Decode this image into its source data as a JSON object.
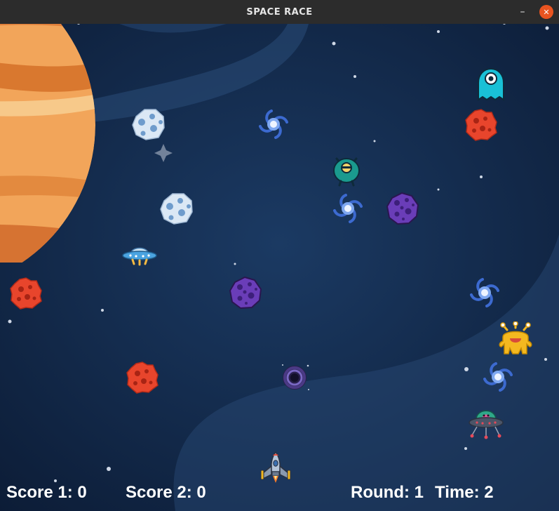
{
  "window": {
    "title": "SPACE RACE",
    "minimize_glyph": "–",
    "close_glyph": "✕"
  },
  "hud": {
    "score1_label": "Score 1:",
    "score1_value": "0",
    "score2_label": "Score 2:",
    "score2_value": "0",
    "round_label": "Round:",
    "round_value": "1",
    "time_label": "Time:",
    "time_value": "2"
  },
  "colors": {
    "space_bg": "#0d1f3c",
    "titlebar": "#2c2c2c",
    "close_button": "#e95420",
    "planet_orange": "#f0a050",
    "meteor_red": "#e8452c",
    "asteroid_purple": "#6a3db8",
    "asteroid_ice": "#dbe8f5",
    "galaxy_blue": "#4a7be0"
  },
  "sprites": {
    "planet": "jupiter-planet-icon",
    "player_ship": "rocket-ship-icon",
    "ufo": "ufo-saucer-icon",
    "alien_ufo": "alien-ufo-icon",
    "ghost_alien": "cyan-ghost-alien-icon",
    "teal_alien": "teal-one-eyed-alien-icon",
    "yellow_alien": "yellow-tentacle-alien-icon",
    "red_meteor": "red-meteor-icon",
    "purple_asteroid": "purple-asteroid-icon",
    "ice_asteroid": "ice-asteroid-icon",
    "spiral_galaxy": "spiral-galaxy-icon",
    "black_hole": "black-hole-icon"
  }
}
